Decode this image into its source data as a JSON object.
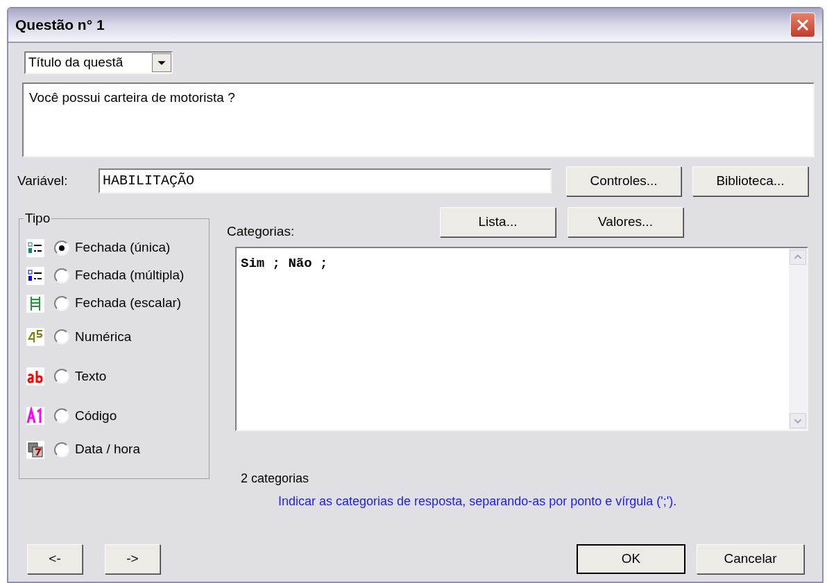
{
  "window": {
    "title": "Questão n° 1"
  },
  "field_selector": {
    "value": "Título da questã"
  },
  "question_text": {
    "value": "Você possui carteira de motorista ?"
  },
  "variable": {
    "label": "Variável:",
    "value": "HABILITAÇÃO"
  },
  "top_buttons": [
    "Controles...",
    "Biblioteca..."
  ],
  "type_group": {
    "title": "Tipo",
    "options": [
      {
        "kind": "single",
        "label": "Fechada (única)",
        "selected": true
      },
      {
        "kind": "multiple",
        "label": "Fechada (múltipla)",
        "selected": false
      },
      {
        "kind": "scale",
        "label": "Fechada (escalar)",
        "selected": false
      },
      {
        "kind": "numeric",
        "label": "Numérica",
        "selected": false
      },
      {
        "kind": "text",
        "label": "Texto",
        "selected": false
      },
      {
        "kind": "code",
        "label": "Código",
        "selected": false
      },
      {
        "kind": "datetime",
        "label": "Data / hora",
        "selected": false
      }
    ]
  },
  "categories": {
    "label": "Categorias:",
    "buttons": [
      "Lista...",
      "Valores..."
    ],
    "value": "Sim ; Não ;",
    "count": "2 categorias",
    "hint": "Indicar as categorias de resposta, separando-as por ponto e vírgula (';')."
  },
  "nav_buttons": [
    "<-",
    "->"
  ],
  "action_buttons": [
    {
      "label": "OK",
      "default": true
    },
    {
      "label": "Cancelar",
      "default": false
    }
  ]
}
